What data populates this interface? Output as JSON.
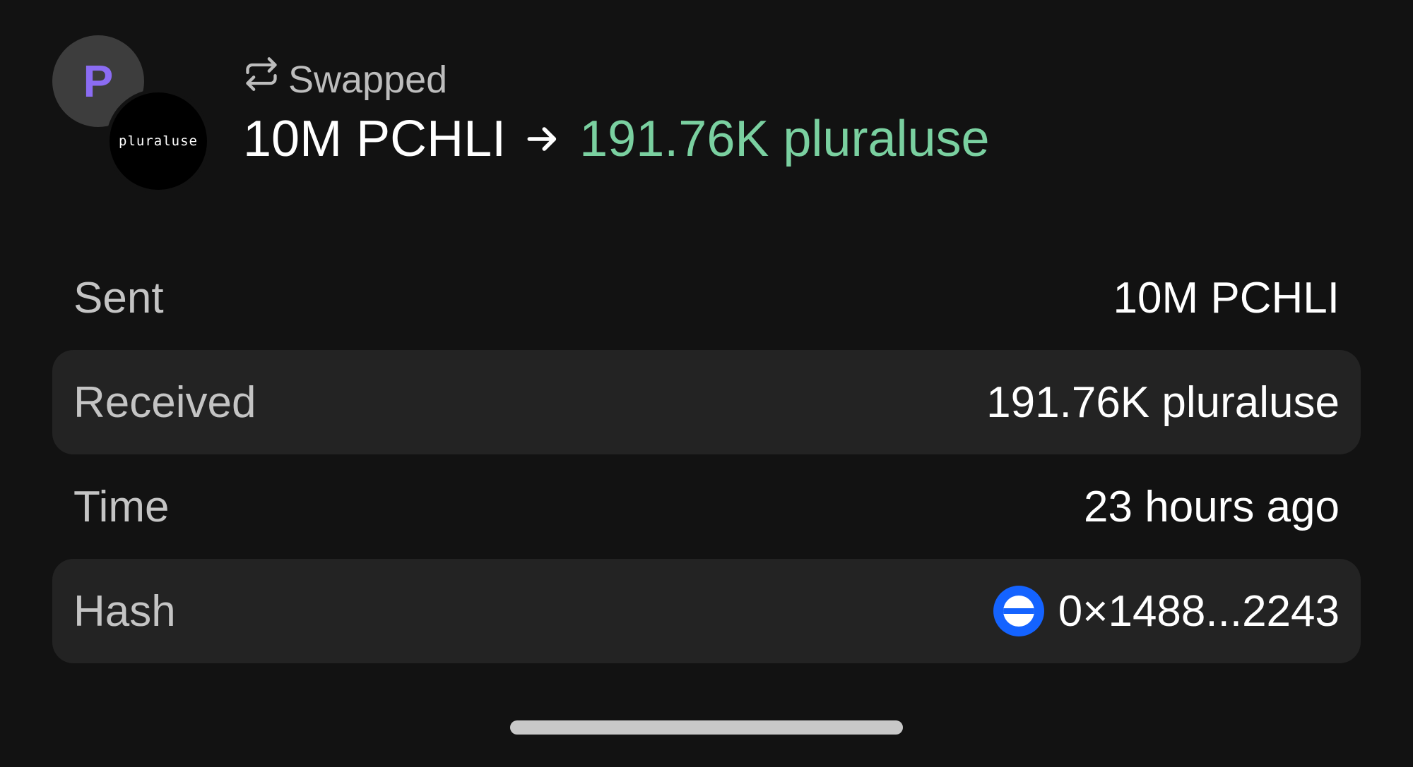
{
  "avatars": {
    "wallet_initial": "P",
    "token_logo_text": "pluraluse"
  },
  "header": {
    "status_label": "Swapped",
    "sent_amount": "10M PCHLI",
    "received_amount": "191.76K pluraluse"
  },
  "details": {
    "sent": {
      "label": "Sent",
      "value": "10M PCHLI"
    },
    "received": {
      "label": "Received",
      "value": "191.76K pluraluse"
    },
    "time": {
      "label": "Time",
      "value": "23 hours ago"
    },
    "hash": {
      "label": "Hash",
      "value": "0×1488...2243",
      "icon": "base-chain-icon"
    }
  },
  "colors": {
    "background": "#121212",
    "row_alt": "#232323",
    "received_accent": "#7ad0a0",
    "avatar_letter": "#8b6cf3",
    "chain_blue": "#1463ff"
  }
}
